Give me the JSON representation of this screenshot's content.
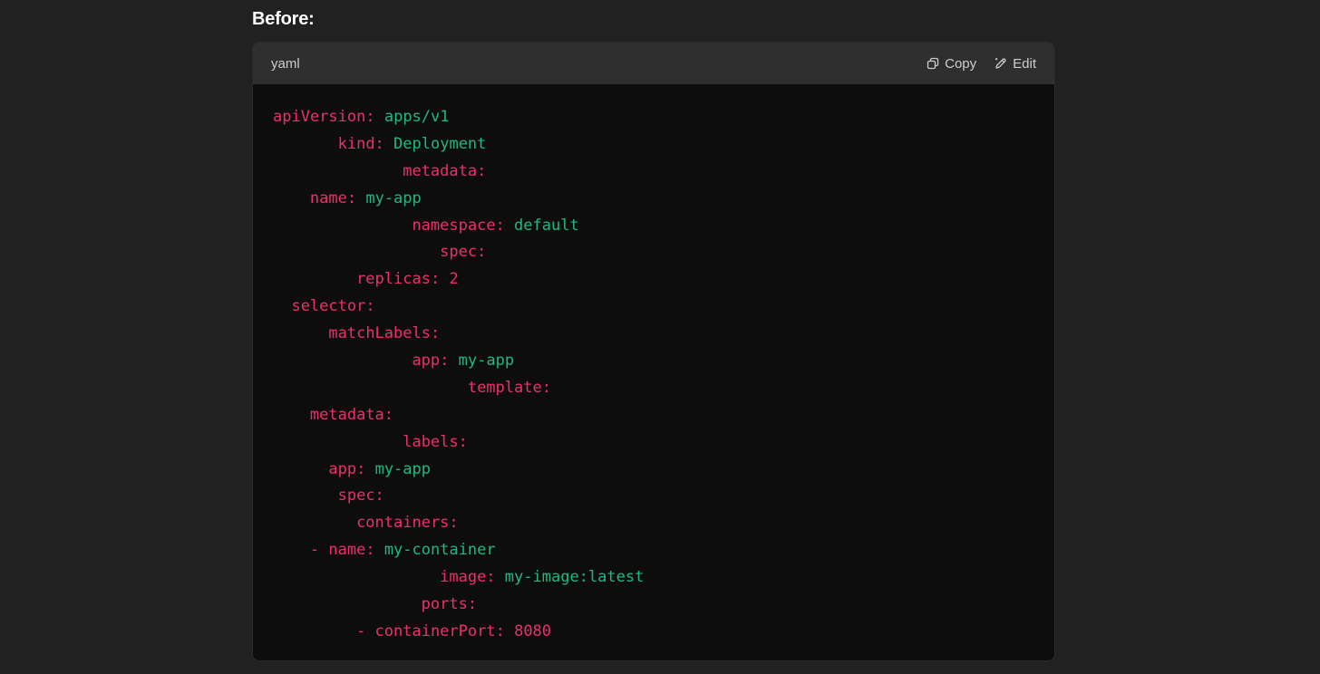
{
  "heading": "Before:",
  "code_block": {
    "language": "yaml",
    "copy_label": "Copy",
    "edit_label": "Edit",
    "icons": {
      "copy": "copy-icon",
      "edit": "pencil-icon"
    },
    "colors": {
      "key": "#ee2f6b",
      "value": "#1fb882",
      "background": "#0d0d0d",
      "header": "#2f2f2f"
    },
    "lines": [
      {
        "indent": 0,
        "key": "apiVersion:",
        "value": "apps/v1",
        "value_type": "string"
      },
      {
        "indent": 7,
        "key": "kind:",
        "value": "Deployment",
        "value_type": "string"
      },
      {
        "indent": 14,
        "key": "metadata:",
        "value": "",
        "value_type": "string"
      },
      {
        "indent": 4,
        "key": "name:",
        "value": "my-app",
        "value_type": "string"
      },
      {
        "indent": 15,
        "key": "namespace:",
        "value": "default",
        "value_type": "string"
      },
      {
        "indent": 18,
        "key": "spec:",
        "value": "",
        "value_type": "string"
      },
      {
        "indent": 9,
        "key": "replicas:",
        "value": "2",
        "value_type": "number"
      },
      {
        "indent": 2,
        "key": "selector:",
        "value": "",
        "value_type": "string"
      },
      {
        "indent": 6,
        "key": "matchLabels:",
        "value": "",
        "value_type": "string"
      },
      {
        "indent": 15,
        "key": "app:",
        "value": "my-app",
        "value_type": "string"
      },
      {
        "indent": 21,
        "key": "template:",
        "value": "",
        "value_type": "string"
      },
      {
        "indent": 4,
        "key": "metadata:",
        "value": "",
        "value_type": "string"
      },
      {
        "indent": 14,
        "key": "labels:",
        "value": "",
        "value_type": "string"
      },
      {
        "indent": 6,
        "key": "app:",
        "value": "my-app",
        "value_type": "string"
      },
      {
        "indent": 7,
        "key": "spec:",
        "value": "",
        "value_type": "string"
      },
      {
        "indent": 9,
        "key": "containers:",
        "value": "",
        "value_type": "string"
      },
      {
        "indent": 4,
        "key": "- name:",
        "value": "my-container",
        "value_type": "string"
      },
      {
        "indent": 18,
        "key": "image:",
        "value": "my-image:latest",
        "value_type": "string"
      },
      {
        "indent": 16,
        "key": "ports:",
        "value": "",
        "value_type": "string"
      },
      {
        "indent": 9,
        "key": "- containerPort:",
        "value": "8080",
        "value_type": "number"
      }
    ]
  }
}
